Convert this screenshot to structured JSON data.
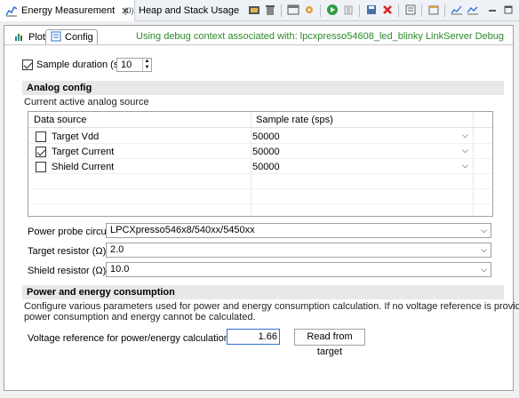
{
  "view_tabs": [
    {
      "label": "Energy Measurement",
      "active": true,
      "closable": true
    },
    {
      "label": "Heap and Stack Usage",
      "active": false
    }
  ],
  "toolbar_icons": [
    "record-icon",
    "delete-icon",
    "export-icon",
    "settings-icon",
    "run-icon",
    "pause-icon",
    "save-icon",
    "remove-icon",
    "view-icon",
    "new-window-icon",
    "chart-icon",
    "chart-alt-icon",
    "minimize-icon",
    "maximize-icon"
  ],
  "subtabs": [
    {
      "label": "Plot",
      "active": false
    },
    {
      "label": "Config",
      "active": true
    }
  ],
  "debug_context": "Using debug context associated with: lpcxpresso54608_led_blinky LinkServer Debug",
  "sample_duration": {
    "label": "Sample duration (s)",
    "checked": true,
    "value": "10"
  },
  "analog": {
    "heading": "Analog config",
    "description": "Current active analog source",
    "columns": [
      "Data source",
      "Sample rate (sps)"
    ],
    "rows": [
      {
        "name": "Target Vdd",
        "checked": false,
        "rate": "50000"
      },
      {
        "name": "Target Current",
        "checked": true,
        "rate": "50000"
      },
      {
        "name": "Shield Current",
        "checked": false,
        "rate": "50000"
      }
    ]
  },
  "power_probe": {
    "label": "Power probe circuit",
    "value": "LPCXpresso546x8/540xx/5450xx"
  },
  "target_resistor": {
    "label": "Target resistor (Ω)",
    "value": "2.0"
  },
  "shield_resistor": {
    "label": "Shield resistor (Ω)",
    "value": "10.0"
  },
  "power": {
    "heading": "Power and energy consumption",
    "desc1": "Configure various parameters used for power and energy consumption calculation. If no voltage reference is provided,",
    "desc2": "power consumption and energy cannot be calculated.",
    "vref_label": "Voltage reference for power/energy calculation (V)",
    "vref_value": "1.66",
    "read_button": "Read from target"
  },
  "colors": {
    "debug_text": "#2b8a2b",
    "accent": "#2e6fd3"
  }
}
